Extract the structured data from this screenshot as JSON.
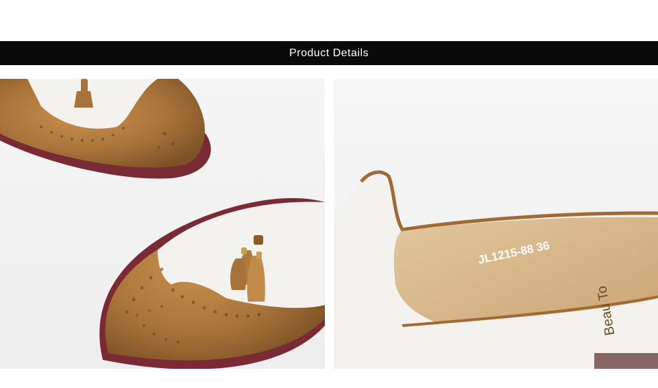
{
  "header": {
    "title": "Product Details"
  },
  "photos": {
    "left": {
      "subject": "brogue-loafer-tassel-closeup"
    },
    "right": {
      "subject": "loafer-insole-closeup",
      "insole_code": "JL1215-88 36",
      "brand_stamp": "Beau To"
    }
  },
  "colors": {
    "banner": "#0a0a0a",
    "leather_tan": "#b07a3c",
    "leather_white": "#f4f2ee",
    "sole": "#7a2a34",
    "insole": "#d9b98a"
  }
}
